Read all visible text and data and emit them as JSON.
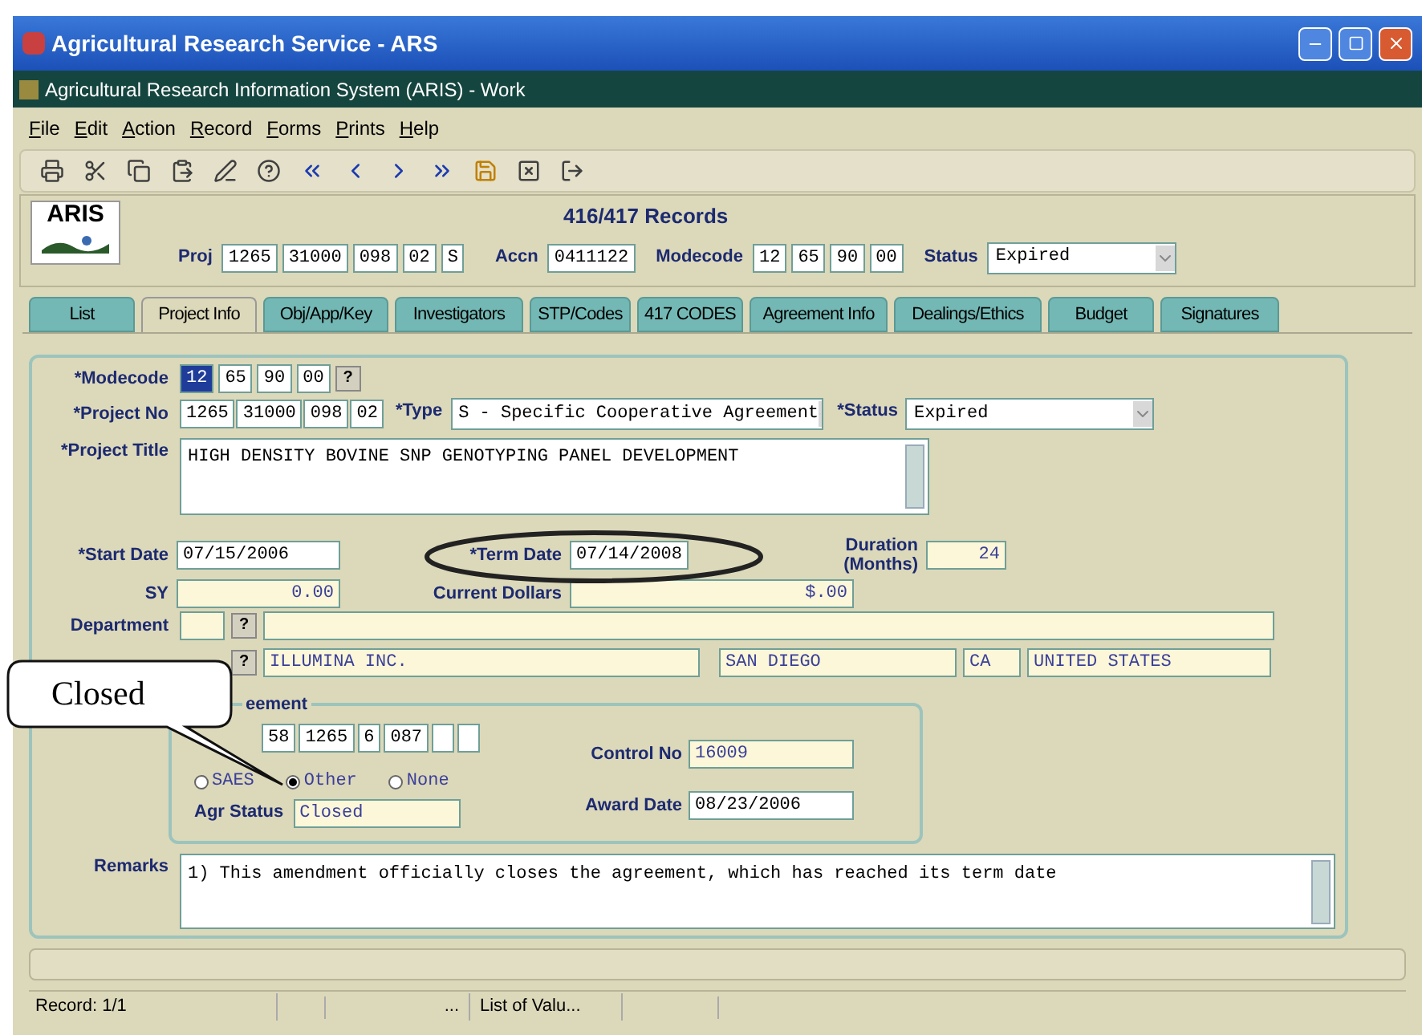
{
  "window": {
    "title": "Agricultural Research Service - ARS"
  },
  "app_title": "Agricultural Research Information System (ARIS) - Work",
  "menu": [
    "File",
    "Edit",
    "Action",
    "Record",
    "Forms",
    "Prints",
    "Help"
  ],
  "header": {
    "logo": "ARIS",
    "title": "416/417 Records",
    "proj_label": "Proj",
    "proj": [
      "1265",
      "31000",
      "098",
      "02",
      "S"
    ],
    "accn_label": "Accn",
    "accn": "0411122",
    "modecode_label": "Modecode",
    "modecode": [
      "12",
      "65",
      "90",
      "00"
    ],
    "status_label": "Status",
    "status": "Expired"
  },
  "tabs": [
    {
      "label": "List",
      "selected": false
    },
    {
      "label": "Project Info",
      "selected": true
    },
    {
      "label": "Obj/App/Key",
      "selected": false
    },
    {
      "label": "Investigators",
      "selected": false
    },
    {
      "label": "STP/Codes",
      "selected": false
    },
    {
      "label": "417 CODES",
      "selected": false
    },
    {
      "label": "Agreement Info",
      "selected": false
    },
    {
      "label": "Dealings/Ethics",
      "selected": false
    },
    {
      "label": "Budget",
      "selected": false
    },
    {
      "label": "Signatures",
      "selected": false
    }
  ],
  "form": {
    "modecode": {
      "label": "*Modecode",
      "parts": [
        {
          "value": "12",
          "selected": true
        },
        {
          "value": "65",
          "selected": false
        },
        {
          "value": "90",
          "selected": false
        },
        {
          "value": "00",
          "selected": false
        }
      ],
      "lookup": "?"
    },
    "project_no": {
      "label": "*Project No",
      "parts": [
        "1265",
        "31000",
        "098",
        "02"
      ]
    },
    "type": {
      "label": "*Type",
      "value": "S - Specific Cooperative Agreement"
    },
    "status": {
      "label": "*Status",
      "value": "Expired"
    },
    "project_title": {
      "label": "*Project Title",
      "value": "HIGH DENSITY BOVINE SNP GENOTYPING PANEL DEVELOPMENT"
    },
    "start_date": {
      "label": "*Start Date",
      "value": "07/15/2006"
    },
    "term_date": {
      "label": "*Term Date",
      "value": "07/14/2008"
    },
    "duration": {
      "label": "Duration (Months)",
      "value": "24"
    },
    "sy": {
      "label": "SY",
      "value": "0.00"
    },
    "current_dollars": {
      "label": "Current Dollars",
      "value": "$.00"
    },
    "department": {
      "label": "Department",
      "lookup": "?"
    },
    "cooperator": {
      "lookup": "?",
      "name": "ILLUMINA INC.",
      "city": "SAN DIEGO",
      "state": "CA",
      "country": "UNITED STATES"
    },
    "agreement": {
      "legend": "eement",
      "parts": [
        "58",
        "1265",
        "6",
        "087"
      ],
      "radios": [
        {
          "label": "SAES",
          "selected": false
        },
        {
          "label": "Other",
          "selected": true
        },
        {
          "label": "None",
          "selected": false
        }
      ],
      "agr_status": {
        "label": "Agr Status",
        "value": "Closed"
      },
      "control_no": {
        "label": "Control No",
        "value": "16009"
      },
      "award_date": {
        "label": "Award Date",
        "value": "08/23/2006"
      }
    },
    "remarks": {
      "label": "Remarks",
      "value": "1) This amendment officially closes the agreement, which has reached its term date"
    }
  },
  "status_bar": [
    "Record: 1/1",
    "...",
    "List of Valu..."
  ],
  "annotation": {
    "callout": "Closed"
  }
}
